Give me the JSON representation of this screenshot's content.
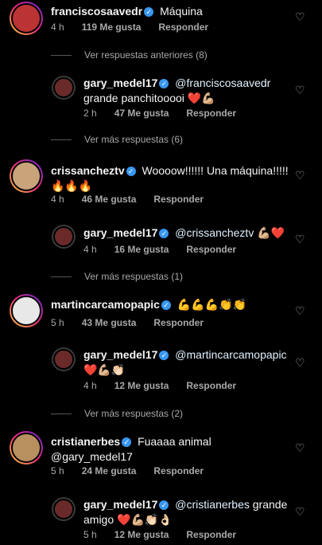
{
  "verified_glyph": "✓",
  "heart_glyph": "♡",
  "comments": [
    {
      "user": "franciscosaavedr",
      "verified": true,
      "text": "Máquina",
      "time": "4 h",
      "likes": "119 Me gusta",
      "reply": "Responder"
    },
    {
      "user": "gary_medel17",
      "verified": true,
      "mention": "@franciscosaavedr",
      "text": "grande panchitooooi ❤️💪🏼",
      "time": "2 h",
      "likes": "47 Me gusta",
      "reply": "Responder"
    },
    {
      "user": "crissancheztv",
      "verified": true,
      "text": "Woooow!!!!!! Una máquina!!!!!",
      "text2": "🔥🔥🔥",
      "time": "4 h",
      "likes": "46 Me gusta",
      "reply": "Responder"
    },
    {
      "user": "gary_medel17",
      "verified": true,
      "mention": "@crissancheztv",
      "text": "💪🏼❤️",
      "time": "4 h",
      "likes": "16 Me gusta",
      "reply": "Responder"
    },
    {
      "user": "martincarcamopapic",
      "verified": true,
      "text": "💪💪💪👏👏",
      "time": "5 h",
      "likes": "43 Me gusta",
      "reply": "Responder"
    },
    {
      "user": "gary_medel17",
      "verified": true,
      "mention": "@martincarcamopapic",
      "text": "❤️💪🏼👏🏻",
      "time": "4 h",
      "likes": "12 Me gusta",
      "reply": "Responder"
    },
    {
      "user": "cristianerbes",
      "verified": true,
      "text": "Fuaaaa animal",
      "text2": "@gary_medel17",
      "time": "5 h",
      "likes": "24 Me gusta",
      "reply": "Responder"
    },
    {
      "user": "gary_medel17",
      "verified": true,
      "mention": "@cristianerbes",
      "text": "grande",
      "text2": "amigo ❤️💪🏼👏🏻👌🏻",
      "time": "5 h",
      "likes": "12 Me gusta",
      "reply": "Responder"
    }
  ],
  "view_prev": "Ver respuestas anteriores (8)",
  "view_more": [
    "Ver más respuestas (6)",
    "Ver más respuestas (1)",
    "Ver más respuestas (2)"
  ]
}
